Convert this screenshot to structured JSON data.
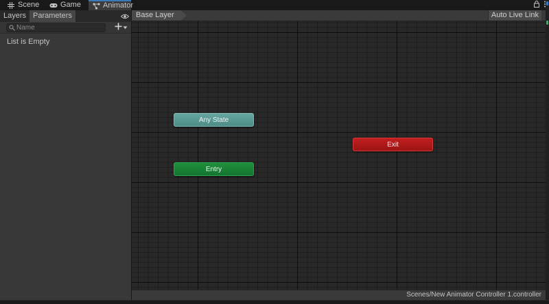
{
  "window_tabs": [
    {
      "label": "Scene",
      "icon": "grid-icon",
      "active": false
    },
    {
      "label": "Game",
      "icon": "gamepad-icon",
      "active": false
    },
    {
      "label": "Animator",
      "icon": "animator-icon",
      "active": true
    }
  ],
  "window_controls": {
    "lock_icon": "lock-icon",
    "menu_icon": "kebab-menu-icon"
  },
  "left_panel": {
    "tabs": [
      {
        "label": "Layers",
        "active": false
      },
      {
        "label": "Parameters",
        "active": true
      }
    ],
    "eye_icon": "eye-icon",
    "search": {
      "placeholder": "Name",
      "value": ""
    },
    "add_icon": "plus-icon",
    "empty_text": "List is Empty"
  },
  "graph": {
    "breadcrumb": "Base Layer",
    "live_link_label": "Auto Live Link",
    "nodes": {
      "any_state": "Any State",
      "entry": "Entry",
      "exit": "Exit"
    },
    "status_path": "Scenes/New Animator Controller 1.controller"
  },
  "colors": {
    "any_state": "#5a9a94",
    "entry": "#1a8636",
    "exit": "#b01a1a",
    "active_tab_accent": "#3a79bb"
  }
}
